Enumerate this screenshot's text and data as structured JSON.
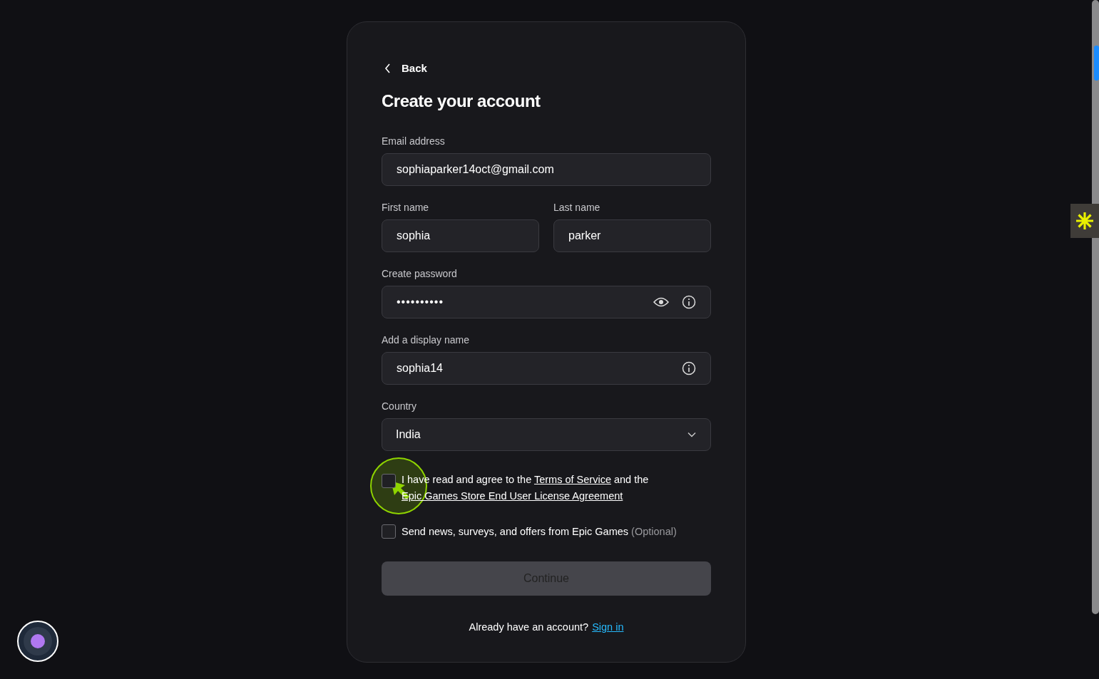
{
  "back": {
    "label": "Back"
  },
  "title": "Create your account",
  "rows": [
    [
      {
        "label": "Email address",
        "value": "sophiaparker14oct@gmail.com",
        "kind": "text"
      }
    ],
    [
      {
        "label": "First name",
        "value": "sophia",
        "kind": "text"
      },
      {
        "label": "Last name",
        "value": "parker",
        "kind": "text"
      }
    ],
    [
      {
        "label": "Create password",
        "value": "••••••••••",
        "kind": "password"
      }
    ],
    [
      {
        "label": "Add a display name",
        "value": "sophia14",
        "kind": "info"
      }
    ],
    [
      {
        "label": "Country",
        "value": "India",
        "kind": "select"
      }
    ]
  ],
  "agreement": {
    "checked": false,
    "parts": [
      {
        "text": "I have read and agree to the ",
        "link": false
      },
      {
        "text": "Terms of Service",
        "link": true
      },
      {
        "text": " and the ",
        "link": false
      },
      {
        "text": "Epic Games Store End User License Agreement",
        "link": true
      }
    ]
  },
  "newsletter": {
    "checked": false,
    "text": "Send news, surveys, and offers from Epic Games",
    "note": "(Optional)"
  },
  "continue": {
    "label": "Continue",
    "disabled": true
  },
  "signin": {
    "prompt": "Already have an account?",
    "link": "Sign in"
  }
}
